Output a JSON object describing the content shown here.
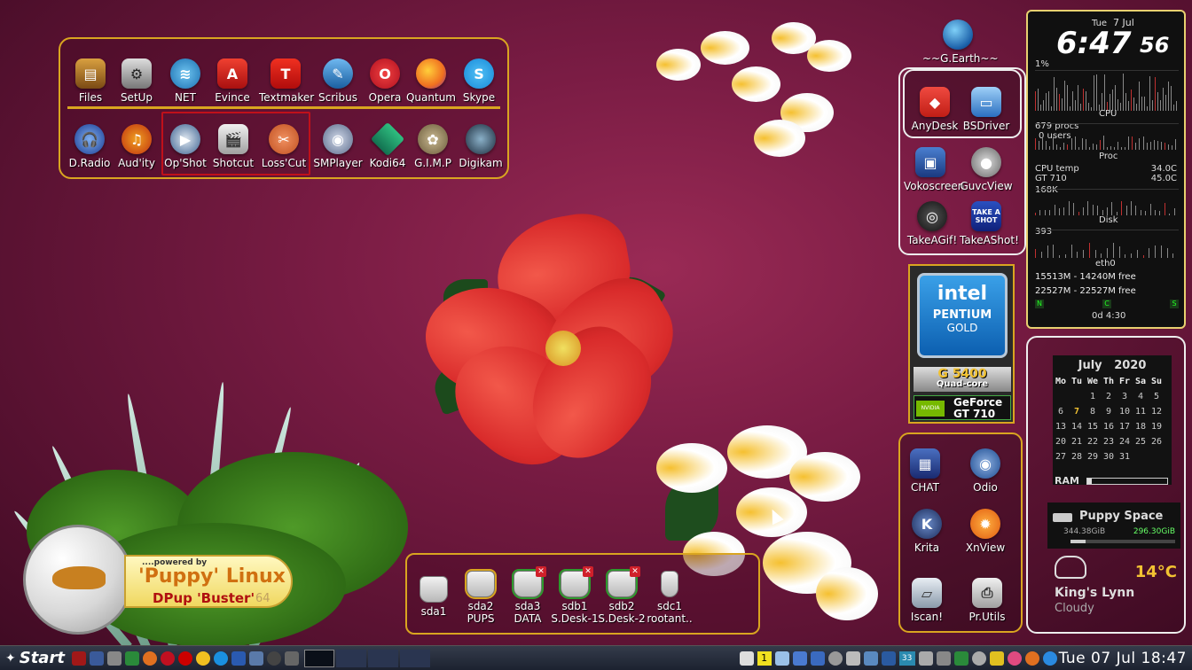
{
  "launcher": {
    "row1": [
      "Files",
      "SetUp",
      "NET",
      "Evince",
      "Textmaker",
      "Scribus",
      "Opera",
      "Quantum",
      "Skype"
    ],
    "row2": [
      "D.Radio",
      "Aud'ity",
      "Op'Shot",
      "Shotcut",
      "Loss'Cut",
      "SMPlayer",
      "Kodi64",
      "G.I.M.P",
      "Digikam"
    ],
    "glyphs1": {
      "textmaker": "T",
      "evince": "A",
      "opera": "O",
      "skype": "S"
    }
  },
  "right_top": {
    "gearth": "~~G.Earth~~"
  },
  "right_panel_a": [
    "AnyDesk",
    "BSDriver"
  ],
  "right_loose": [
    "Vokoscreen",
    "GuvcView",
    "TakeAGif!",
    "TakeAShot!"
  ],
  "takeashot_glyph": "TAKE A SHOT",
  "intel": {
    "brand": "intel",
    "line1": "PENTIUM",
    "line2": "GOLD",
    "model": "G 5400",
    "cores": "Quad-core",
    "nv": "NVIDIA",
    "gpu1": "GeForce",
    "gpu2": "GT 710"
  },
  "right_panel_b": [
    "CHAT",
    "Odio",
    "Krita",
    "XnView",
    "Iscan!",
    "Pr.Utils"
  ],
  "conky": {
    "day": "Tue",
    "date": "7 Jul",
    "time": "6:47",
    "seconds": "56",
    "cpu_pct": "1%",
    "cpu": "CPU",
    "procs": "679 procs",
    "users": "0 users",
    "proc": "Proc",
    "cpu_temp": "CPU temp",
    "cpu_temp_val": "34.0C",
    "gt": "GT 710",
    "gt_val": "45.0C",
    "disk_val": "168K",
    "disk": "Disk",
    "net_val": "393",
    "eth": "eth0",
    "mem1": "15513M - 14240M free",
    "mem2": "22527M - 22527M free",
    "n": "N",
    "c": "C",
    "s": "S",
    "uptime": "0d 4:30"
  },
  "calendar": {
    "title": "July   2020",
    "days": [
      "Mo",
      "Tu",
      "We",
      "Th",
      "Fr",
      "Sa",
      "Su"
    ],
    "cells": [
      "",
      "",
      "1",
      "2",
      "3",
      "4",
      "5",
      "6",
      "7",
      "8",
      "9",
      "10",
      "11",
      "12",
      "13",
      "14",
      "15",
      "16",
      "17",
      "18",
      "19",
      "20",
      "21",
      "22",
      "23",
      "24",
      "25",
      "26",
      "27",
      "28",
      "29",
      "30",
      "31",
      "",
      ""
    ],
    "ram": "RAM",
    "ram_fraction": 0.06,
    "puppy_space": "Puppy Space",
    "space_total": "344.38GiB",
    "space_free": "296.30GiB",
    "temp": "14°C",
    "town": "King's Lynn",
    "weather": "Cloudy"
  },
  "puppy": {
    "powered": "....powered by",
    "name": "'Puppy' Linux",
    "sub": "DPup 'Buster'",
    "arch": "64"
  },
  "drives": [
    {
      "line1": "sda1",
      "line2": ""
    },
    {
      "line1": "sda2",
      "line2": "PUPS"
    },
    {
      "line1": "sda3",
      "line2": "DATA"
    },
    {
      "line1": "sdb1",
      "line2": "S.Desk-1"
    },
    {
      "line1": "sdb2",
      "line2": "S.Desk-2"
    },
    {
      "line1": "sdc1",
      "line2": "rootant.."
    }
  ],
  "taskbar": {
    "start": "Start",
    "clock": "Tue 07 Jul 18:47",
    "tray_badge": "1",
    "tray_temp": "33"
  },
  "colors": {
    "panel_border": "#d9a520",
    "highlight_border": "#c0101a",
    "drive_ok": "#2e9a2e",
    "calendar_today": "#f2c232",
    "weather_temp": "#f2c232"
  }
}
